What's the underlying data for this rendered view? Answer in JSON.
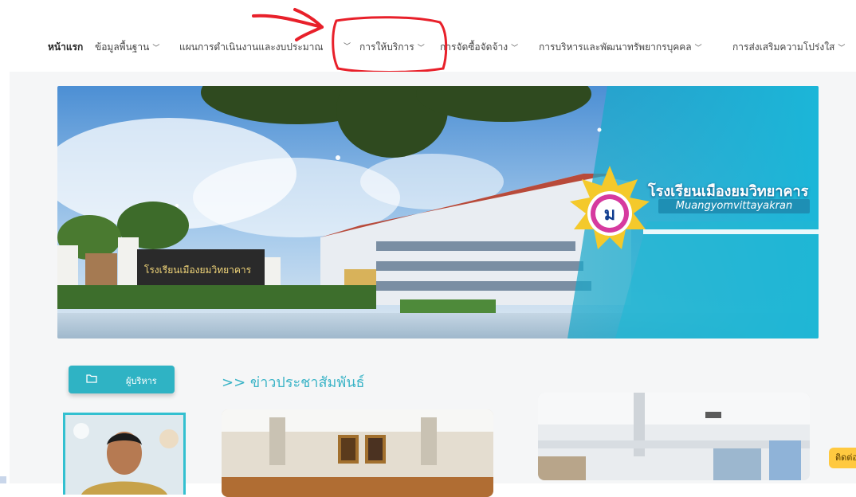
{
  "nav": {
    "items": [
      {
        "label": "หน้าแรก",
        "has_dropdown": false
      },
      {
        "label": "ข้อมูลพื้นฐาน",
        "has_dropdown": true
      },
      {
        "label": "แผนการดำเนินงานและงบประมาณ",
        "has_dropdown": true
      },
      {
        "label": "การให้บริการ",
        "has_dropdown": true
      },
      {
        "label": "การจัดซื้อจัดจ้าง",
        "has_dropdown": true
      },
      {
        "label": "การบริหารและพัฒนาทรัพยากรบุคคล",
        "has_dropdown": true
      },
      {
        "label": "การส่งเสริมความโปร่งใส",
        "has_dropdown": true
      }
    ],
    "highlighted_item": "การให้บริการ",
    "chevron_icon": "chevron-down-icon"
  },
  "annotation": {
    "color": "#e8202a"
  },
  "banner": {
    "school_name_th": "โรงเรียนเมืองยมวิทยาคาร",
    "school_name_en": "Muangyomvittayakran",
    "gate_sign": "โรงเรียนเมืองยมวิทยาคาร",
    "logo_letter": "ม",
    "accent_color": "#1e8fb4"
  },
  "sidebar": {
    "admin_button_label": "ผู้บริหาร",
    "admin_icon": "folder-icon"
  },
  "news": {
    "heading": ">> ข่าวประชาสัมพันธ์"
  },
  "contact_tab": {
    "label": "ติดต่อ"
  },
  "colors": {
    "teal": "#2fb3c4",
    "heading": "#3bb4c7",
    "contact": "#ffc940"
  }
}
